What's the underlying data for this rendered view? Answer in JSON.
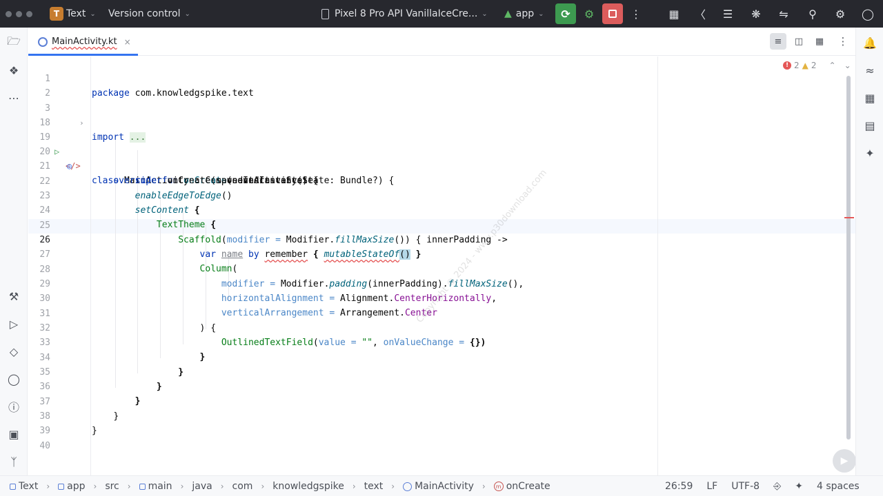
{
  "titlebar": {
    "project_badge": "T",
    "project_name": "Text",
    "vcs_label": "Version control",
    "device_label": "Pixel 8 Pro API VanillaIceCre...",
    "run_config": "app"
  },
  "tab": {
    "label": "MainActivity.kt",
    "close": "×"
  },
  "inspection": {
    "errors": "2",
    "warnings": "2"
  },
  "editor": {
    "lines": [
      {
        "n": "1"
      },
      {
        "n": "2"
      },
      {
        "n": "3"
      },
      {
        "n": "18"
      },
      {
        "n": "19"
      },
      {
        "n": "20"
      },
      {
        "n": "21"
      },
      {
        "n": "22"
      },
      {
        "n": "23"
      },
      {
        "n": "24"
      },
      {
        "n": "25"
      },
      {
        "n": "26"
      },
      {
        "n": "27"
      },
      {
        "n": "28"
      },
      {
        "n": "29"
      },
      {
        "n": "30"
      },
      {
        "n": "31"
      },
      {
        "n": "32"
      },
      {
        "n": "33"
      },
      {
        "n": "34"
      },
      {
        "n": "35"
      },
      {
        "n": "36"
      },
      {
        "n": "37"
      },
      {
        "n": "38"
      },
      {
        "n": "39"
      },
      {
        "n": "40"
      }
    ],
    "tok": {
      "package_kw": "package",
      "package_name": " com.knowledgspike.text",
      "import_kw": "import",
      "import_fold": "...",
      "class_kw": "class",
      "class_rest": " MainActivity : ComponentActivity() {",
      "override_kw": "override fun",
      "oncreate_fn": "onCreate",
      "oncreate_rest": "(savedInstanceState: Bundle?) {",
      "super_kw": "super",
      "super_rest": ".onCreate(savedInstanceState)",
      "edge_fn": "enableEdgeToEdge",
      "edge_rest": "()",
      "setcontent_fn": "setContent",
      "setcontent_rest": " {",
      "theme": "TextTheme",
      "theme_rest": " {",
      "scaffold": "Scaffold",
      "scaffold_open": "(",
      "modifier_param": "modifier =",
      "scaffold_mod": " Modifier.",
      "fillmax": "fillMaxSize",
      "scaffold_rest": "()) { innerPadding ->",
      "var_kw": "var",
      "name_var": "name",
      "by_kw": " by ",
      "remember_fn": "remember",
      "brace_open": " { ",
      "mutable_fn": "mutableStateOf",
      "paren_open": "(",
      "paren_close": ")",
      "brace_close": " }",
      "column": "Column",
      "column_open": "(",
      "modifier_param2": "modifier =",
      "mod2_a": " Modifier.",
      "padding_fn": "padding",
      "mod2_b": "(innerPadding).",
      "fillmax2": "fillMaxSize",
      "mod2_c": "(),",
      "halign_param": "horizontalAlignment =",
      "halign_a": " Alignment.",
      "halign_b": "CenterHorizontally",
      "halign_c": ",",
      "varr_param": "verticalArrangement =",
      "varr_a": " Arrangement.",
      "varr_b": "Center",
      "col_close": ") {",
      "otf": "OutlinedTextField",
      "otf_open": "(",
      "value_param": "value =",
      "str_empty": " \"\"",
      "comma": ", ",
      "onvc_param": "onValueChange =",
      "otf_rest": " {})",
      "close_brace": "}"
    }
  },
  "watermark": "Copyright © 2024 - www.p30download.com",
  "statusbar": {
    "crumbs": [
      "Text",
      "app",
      "src",
      "main",
      "java",
      "com",
      "knowledgspike",
      "text",
      "MainActivity",
      "onCreate"
    ],
    "position": "26:59",
    "line_sep": "LF",
    "encoding": "UTF-8",
    "indent": "4 spaces"
  },
  "colors": {
    "accent": "#3574f0",
    "run": "#3d9a50",
    "stop": "#db5c5c",
    "titlebar": "#27282e"
  }
}
